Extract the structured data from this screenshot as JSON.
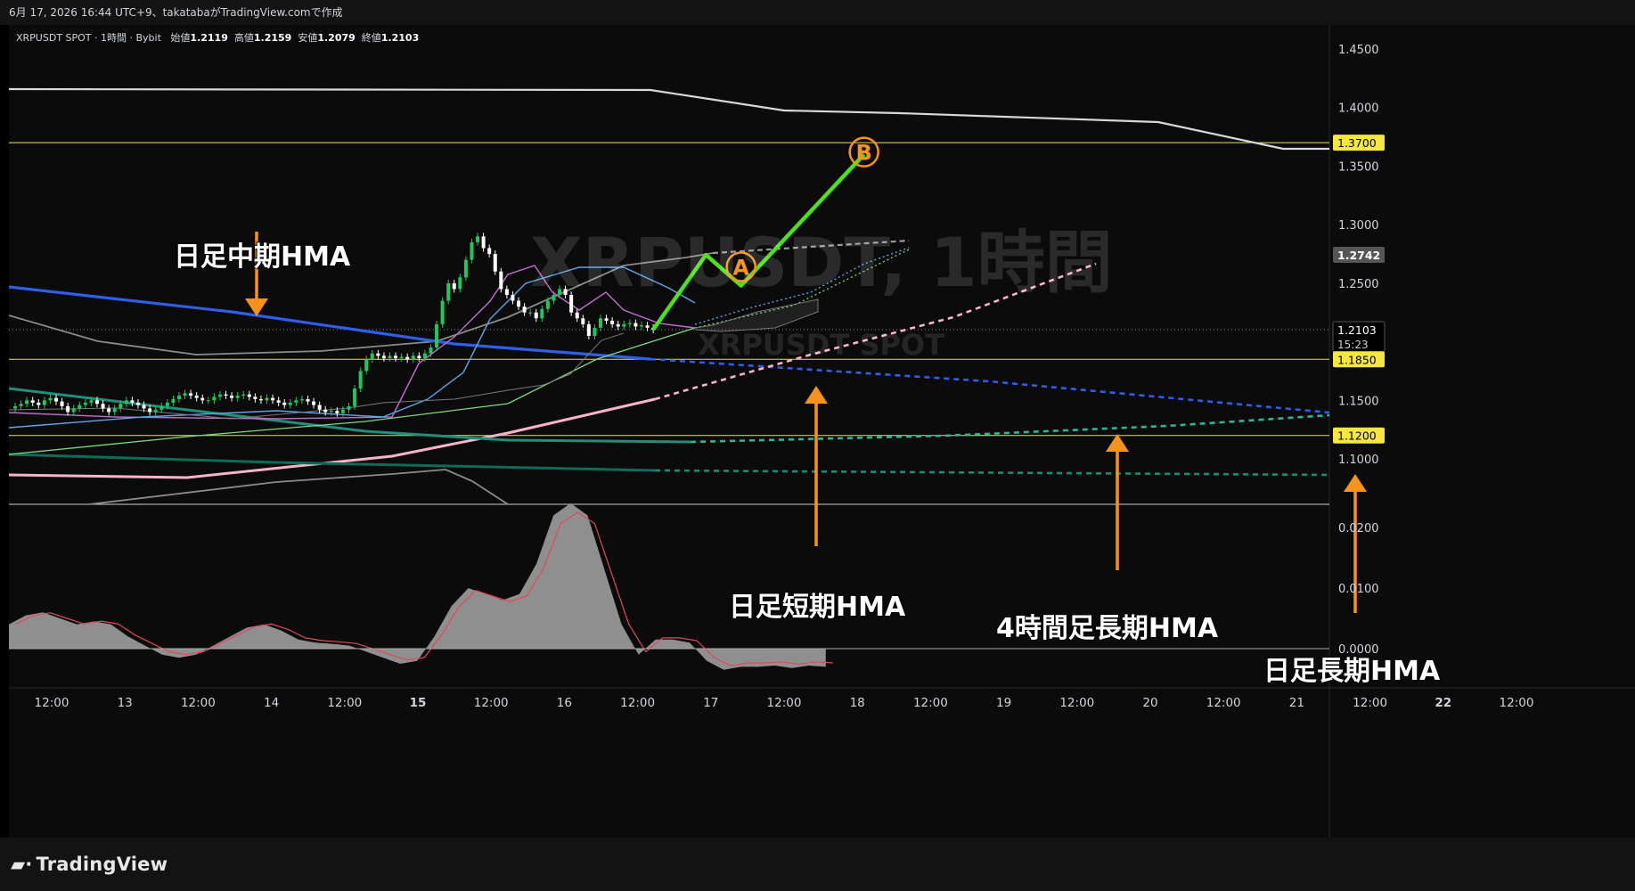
{
  "header": {
    "text": "6月 17, 2026 16:44 UTC+9、takatabaがTradingView.comで作成"
  },
  "legend": {
    "symbol": "XRPUSDT SPOT · 1時間 · Bybit",
    "open_label": "始値",
    "open": "1.2119",
    "high_label": "高値",
    "high": "1.2159",
    "low_label": "安値",
    "low": "1.2079",
    "close_label": "終値",
    "close": "1.2103"
  },
  "watermark": {
    "main": "XRPUSDT, 1時間",
    "sub": "XRPUSDT SPOT"
  },
  "annotations": {
    "mid_hma": "日足中期HMA",
    "short_hma": "日足短期HMA",
    "h4_long_hma": "4時間足長期HMA",
    "long_hma": "日足長期HMA",
    "marker_a": "A",
    "marker_b": "B"
  },
  "footer": {
    "logo": "TradingView"
  },
  "colors": {
    "up": "#22c55e",
    "down": "#ffffff",
    "green_path": "#4ce11b",
    "orange": "#f7931a",
    "blue_hma": "#2f5fe8",
    "pink_hma": "#f8b4c8",
    "teal_hma": "#1f8f7a",
    "teal_dark": "#0f6b5a",
    "yellow_line": "#e8e25a"
  },
  "chart_data": {
    "type": "candlestick",
    "x_ticks": [
      "12:00",
      "13",
      "12:00",
      "14",
      "12:00",
      "15",
      "12:00",
      "16",
      "12:00",
      "17",
      "12:00",
      "18",
      "12:00",
      "19",
      "12:00",
      "20",
      "12:00",
      "21",
      "12:00",
      "22",
      "12:00"
    ],
    "y_ticks": [
      "1.4500",
      "1.4000",
      "1.3500",
      "1.3000",
      "1.2500",
      "1.1500",
      "1.1000"
    ],
    "ylim": [
      1.06,
      1.47
    ],
    "price_labels": [
      {
        "value": 1.37,
        "text": "1.3700",
        "kind": "hline"
      },
      {
        "value": 1.2742,
        "text": "1.2742",
        "kind": "marker"
      },
      {
        "value": 1.2103,
        "text": "1.2103",
        "kind": "last",
        "countdown": "15:23"
      },
      {
        "value": 1.185,
        "text": "1.1850",
        "kind": "hline"
      },
      {
        "value": 1.12,
        "text": "1.1200",
        "kind": "hline"
      }
    ],
    "scenario_path": [
      {
        "t": 109,
        "y": 1.2103
      },
      {
        "t": 118,
        "y": 1.2742
      },
      {
        "t": 124,
        "y": 1.248
      },
      {
        "t": 145,
        "y": 1.36
      }
    ],
    "markers": [
      {
        "label": "A",
        "t": 124,
        "y": 1.264
      },
      {
        "label": "B",
        "t": 145,
        "y": 1.362
      }
    ],
    "candle_closes": [
      1.145,
      1.147,
      1.15,
      1.148,
      1.146,
      1.15,
      1.152,
      1.149,
      1.145,
      1.14,
      1.143,
      1.146,
      1.148,
      1.15,
      1.147,
      1.143,
      1.14,
      1.143,
      1.147,
      1.15,
      1.148,
      1.146,
      1.143,
      1.14,
      1.142,
      1.145,
      1.148,
      1.151,
      1.154,
      1.156,
      1.154,
      1.152,
      1.15,
      1.15,
      1.153,
      1.155,
      1.154,
      1.152,
      1.154,
      1.155,
      1.153,
      1.151,
      1.15,
      1.152,
      1.15,
      1.148,
      1.146,
      1.148,
      1.15,
      1.151,
      1.149,
      1.146,
      1.142,
      1.14,
      1.141,
      1.139,
      1.142,
      1.145,
      1.16,
      1.175,
      1.185,
      1.19,
      1.188,
      1.186,
      1.188,
      1.186,
      1.187,
      1.185,
      1.188,
      1.186,
      1.19,
      1.195,
      1.215,
      1.235,
      1.25,
      1.245,
      1.255,
      1.27,
      1.285,
      1.29,
      1.28,
      1.275,
      1.26,
      1.245,
      1.24,
      1.235,
      1.23,
      1.225,
      1.225,
      1.22,
      1.228,
      1.235,
      1.24,
      1.245,
      1.24,
      1.225,
      1.22,
      1.215,
      1.205,
      1.212,
      1.22,
      1.218,
      1.215,
      1.213,
      1.215,
      1.216,
      1.213,
      1.214,
      1.212,
      1.2103
    ],
    "oscillator": {
      "yticks": [
        "0.0200",
        "0.0100",
        "0.0000"
      ],
      "values": [
        0.004,
        0.0055,
        0.006,
        0.005,
        0.004,
        0.0045,
        0.004,
        0.002,
        0.0005,
        -0.001,
        -0.0015,
        -0.001,
        0.0005,
        0.002,
        0.0035,
        0.004,
        0.003,
        0.0015,
        0.001,
        0.0008,
        0.0005,
        -0.0005,
        -0.0015,
        -0.0025,
        -0.002,
        0.002,
        0.007,
        0.01,
        0.009,
        0.008,
        0.009,
        0.014,
        0.022,
        0.024,
        0.022,
        0.013,
        0.004,
        -0.001,
        0.0015,
        0.0015,
        0.001,
        -0.002,
        -0.0035,
        -0.003,
        -0.003,
        -0.0028,
        -0.0032,
        -0.0028,
        -0.003
      ]
    }
  }
}
